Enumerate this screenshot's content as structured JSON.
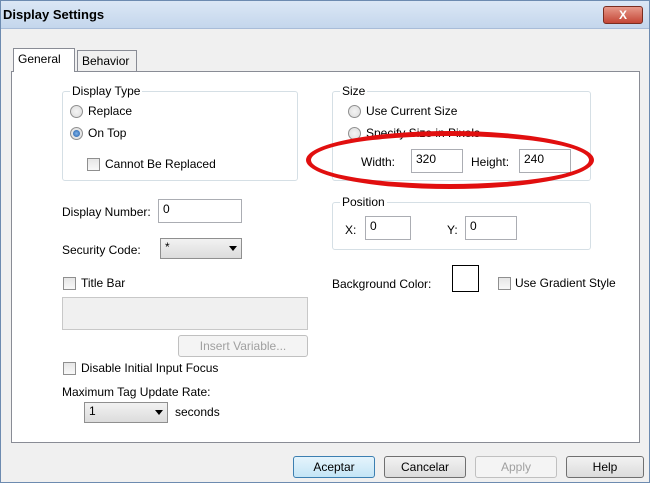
{
  "window": {
    "title": "Display Settings",
    "close_glyph": "X"
  },
  "tabs": [
    {
      "label": "General"
    },
    {
      "label": "Behavior"
    }
  ],
  "display_type": {
    "legend": "Display Type",
    "replace_label": "Replace",
    "on_top_label": "On Top",
    "cannot_be_replaced_label": "Cannot Be Replaced",
    "selected": "On Top"
  },
  "size": {
    "legend": "Size",
    "use_current_label": "Use Current Size",
    "specify_label": "Specify Size in Pixels",
    "width_label": "Width:",
    "width_value": "320",
    "height_label": "Height:",
    "height_value": "240"
  },
  "display_number": {
    "label": "Display Number:",
    "value": "0"
  },
  "position": {
    "legend": "Position",
    "x_label": "X:",
    "x_value": "0",
    "y_label": "Y:",
    "y_value": "0"
  },
  "security_code": {
    "label": "Security Code:",
    "value": "*"
  },
  "background": {
    "label": "Background Color:",
    "color": "#ffffff",
    "gradient_label": "Use Gradient Style"
  },
  "title_bar": {
    "label": "Title Bar"
  },
  "insert_variable_label": "Insert Variable...",
  "disable_focus_label": "Disable Initial Input Focus",
  "update_rate": {
    "label": "Maximum Tag Update Rate:",
    "value": "1",
    "unit": "seconds"
  },
  "buttons": {
    "ok": "Aceptar",
    "cancel": "Cancelar",
    "apply": "Apply",
    "help": "Help"
  },
  "colors": {
    "highlight_ring": "#e10f0f"
  }
}
